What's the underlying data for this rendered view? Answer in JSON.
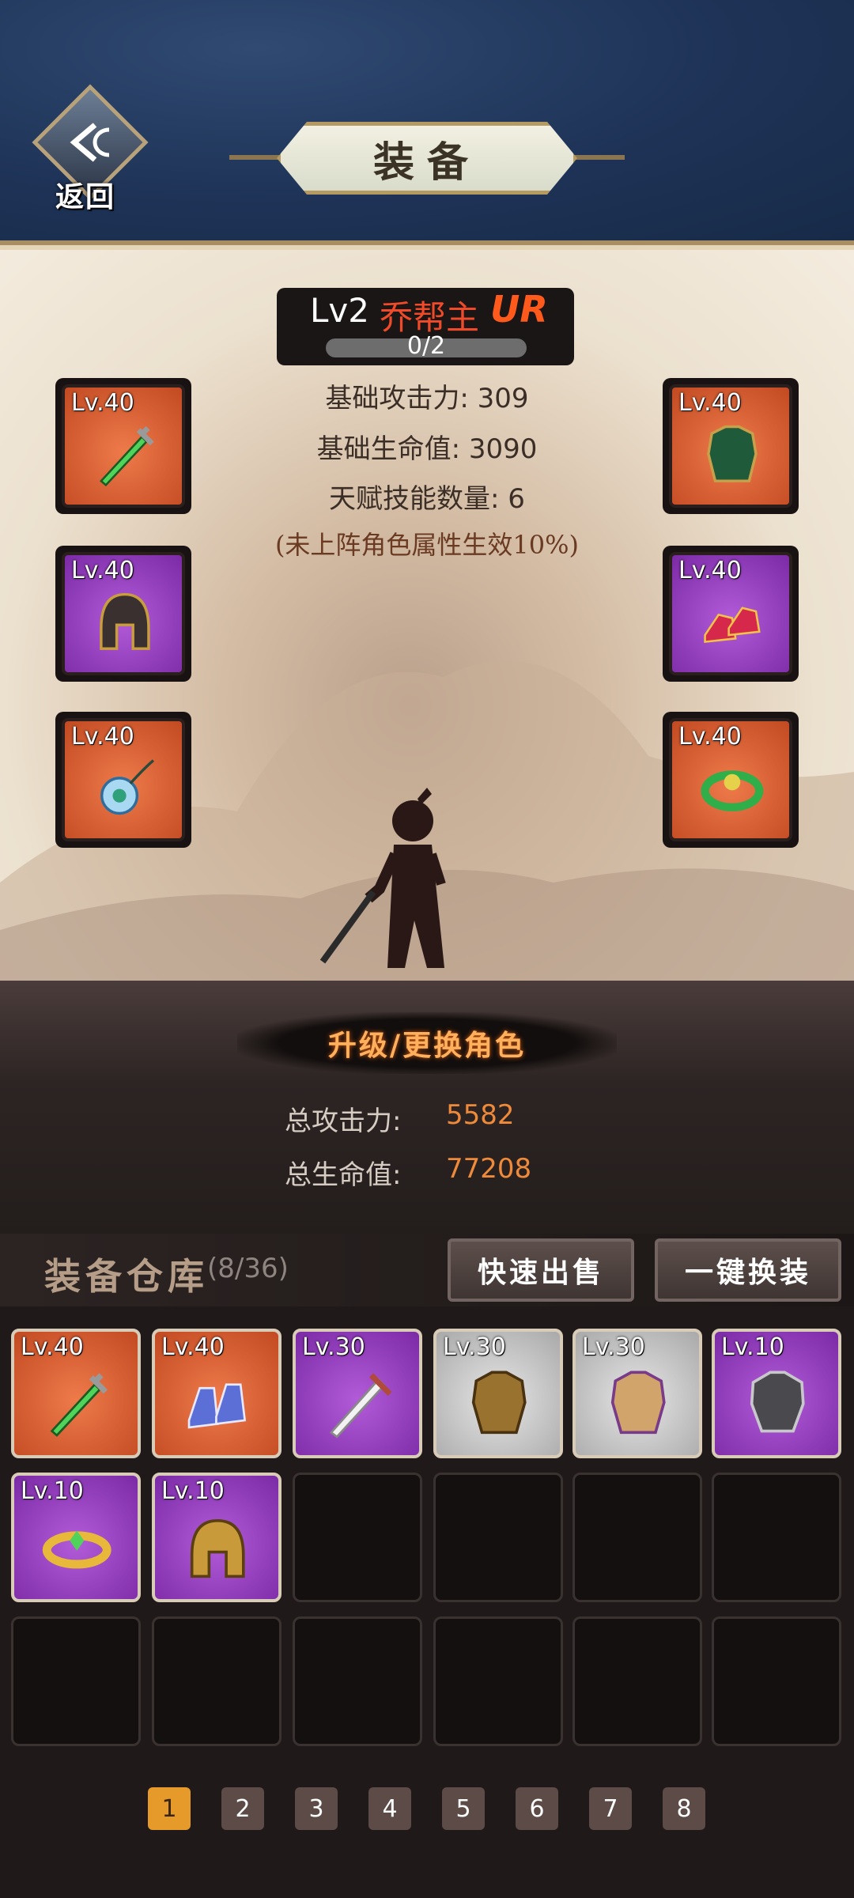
{
  "header": {
    "back_label": "返回",
    "title": "装备"
  },
  "hero": {
    "level": "Lv2",
    "name": "乔帮主",
    "rarity": "UR",
    "progress_text": "0/2",
    "base_attack": "基础攻击力: 309",
    "base_hp": "基础生命值: 3090",
    "talent_count": "天赋技能数量: 6",
    "note": "(未上阵角色属性生效10%)"
  },
  "equipped": [
    {
      "level": "Lv.40",
      "icon": "jade-dagger-icon",
      "color": "orange"
    },
    {
      "level": "Lv.40",
      "icon": "iron-helmet-icon",
      "color": "purple"
    },
    {
      "level": "Lv.40",
      "icon": "jade-pendant-icon",
      "color": "orange"
    },
    {
      "level": "Lv.40",
      "icon": "green-armor-icon",
      "color": "orange"
    },
    {
      "level": "Lv.40",
      "icon": "red-boots-icon",
      "color": "purple"
    },
    {
      "level": "Lv.40",
      "icon": "jade-ring-icon",
      "color": "orange"
    }
  ],
  "action": {
    "upgrade_label": "升级/更换角色"
  },
  "totals": {
    "attack_label": "总攻击力:",
    "attack_value": "5582",
    "hp_label": "总生命值:",
    "hp_value": "77208"
  },
  "storage": {
    "title": "装备仓库",
    "count": "(8/36)",
    "quick_sell": "快速出售",
    "one_click_equip": "一键换装",
    "items": [
      {
        "level": "Lv.40",
        "icon": "jade-dagger-icon",
        "color": "orange"
      },
      {
        "level": "Lv.40",
        "icon": "blue-boots-icon",
        "color": "orange"
      },
      {
        "level": "Lv.30",
        "icon": "white-sword-icon",
        "color": "purple"
      },
      {
        "level": "Lv.30",
        "icon": "bronze-armor-icon",
        "color": "silver"
      },
      {
        "level": "Lv.30",
        "icon": "gold-armor-icon",
        "color": "silver"
      },
      {
        "level": "Lv.10",
        "icon": "steel-armor-icon",
        "color": "purple"
      },
      {
        "level": "Lv.10",
        "icon": "gold-ring-icon",
        "color": "purple"
      },
      {
        "level": "Lv.10",
        "icon": "gold-helmet-icon",
        "color": "purple"
      }
    ]
  },
  "pagination": {
    "pages": [
      "1",
      "2",
      "3",
      "4",
      "5",
      "6",
      "7",
      "8"
    ],
    "active": "1"
  },
  "colors": {
    "orange_rarity": "#d8582a",
    "purple_rarity": "#9a3fc8",
    "silver_rarity": "#c8c8c8",
    "value_orange": "#ef8a3a"
  }
}
